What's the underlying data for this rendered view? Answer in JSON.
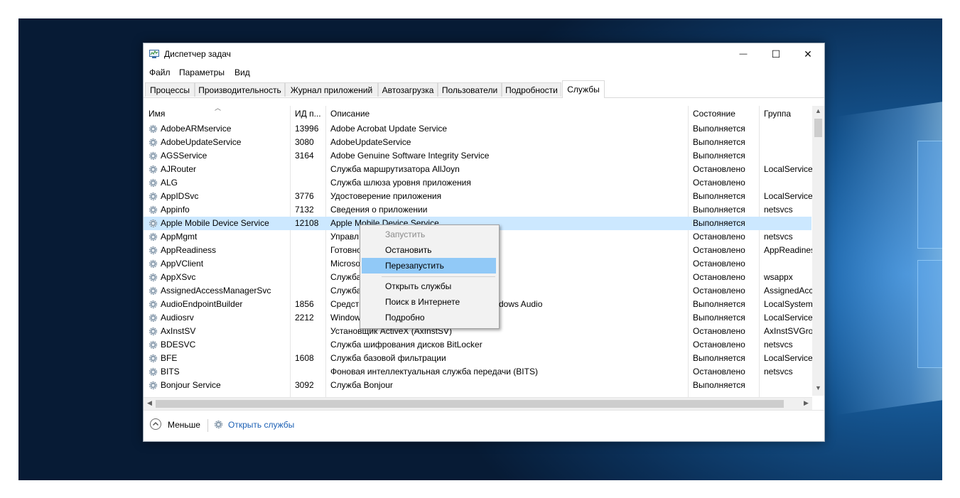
{
  "window": {
    "title": "Диспетчер задач",
    "controls": {
      "minimize": "—",
      "maximize": "☐",
      "close": "✕"
    }
  },
  "menu": [
    "Файл",
    "Параметры",
    "Вид"
  ],
  "tabs": [
    "Процессы",
    "Производительность",
    "Журнал приложений",
    "Автозагрузка",
    "Пользователи",
    "Подробности",
    "Службы"
  ],
  "active_tab": "Службы",
  "columns": {
    "name": "Имя",
    "pid": "ИД п...",
    "description": "Описание",
    "status": "Состояние",
    "group": "Группа"
  },
  "rows": [
    {
      "name": "AdobeARMservice",
      "pid": "13996",
      "description": "Adobe Acrobat Update Service",
      "status": "Выполняется",
      "group": ""
    },
    {
      "name": "AdobeUpdateService",
      "pid": "3080",
      "description": "AdobeUpdateService",
      "status": "Выполняется",
      "group": ""
    },
    {
      "name": "AGSService",
      "pid": "3164",
      "description": "Adobe Genuine Software Integrity Service",
      "status": "Выполняется",
      "group": ""
    },
    {
      "name": "AJRouter",
      "pid": "",
      "description": "Служба маршрутизатора AllJoyn",
      "status": "Остановлено",
      "group": "LocalServiceN"
    },
    {
      "name": "ALG",
      "pid": "",
      "description": "Служба шлюза уровня приложения",
      "status": "Остановлено",
      "group": ""
    },
    {
      "name": "AppIDSvc",
      "pid": "3776",
      "description": "Удостоверение приложения",
      "status": "Выполняется",
      "group": "LocalServiceN"
    },
    {
      "name": "Appinfo",
      "pid": "7132",
      "description": "Сведения о приложении",
      "status": "Выполняется",
      "group": "netsvcs"
    },
    {
      "name": "Apple Mobile Device Service",
      "pid": "12108",
      "description": "Apple Mobile Device Service",
      "status": "Выполняется",
      "group": ""
    },
    {
      "name": "AppMgmt",
      "pid": "",
      "description": "Управл",
      "status": "Остановлено",
      "group": "netsvcs"
    },
    {
      "name": "AppReadiness",
      "pid": "",
      "description": "Готовно",
      "status": "Остановлено",
      "group": "AppReadines"
    },
    {
      "name": "AppVClient",
      "pid": "",
      "description": "Microso",
      "status": "Остановлено",
      "group": ""
    },
    {
      "name": "AppXSvc",
      "pid": "",
      "description": "Служба",
      "status": "Остановлено",
      "group": "wsappx"
    },
    {
      "name": "AssignedAccessManagerSvc",
      "pid": "",
      "description": "Служба",
      "status": "Остановлено",
      "group": "AssignedAcc"
    },
    {
      "name": "AudioEndpointBuilder",
      "pid": "1856",
      "description": "Средств",
      "description_tail": "dows Audio",
      "status": "Выполняется",
      "group": "LocalSystemN"
    },
    {
      "name": "Audiosrv",
      "pid": "2212",
      "description": "Window",
      "status": "Выполняется",
      "group": "LocalServiceN"
    },
    {
      "name": "AxInstSV",
      "pid": "",
      "description": "Установщик ActiveX (AxInstSV)",
      "status": "Остановлено",
      "group": "AxInstSVGrou"
    },
    {
      "name": "BDESVC",
      "pid": "",
      "description": "Служба шифрования дисков BitLocker",
      "status": "Остановлено",
      "group": "netsvcs"
    },
    {
      "name": "BFE",
      "pid": "1608",
      "description": "Служба базовой фильтрации",
      "status": "Выполняется",
      "group": "LocalServiceN"
    },
    {
      "name": "BITS",
      "pid": "",
      "description": "Фоновая интеллектуальная служба передачи (BITS)",
      "status": "Остановлено",
      "group": "netsvcs"
    },
    {
      "name": "Bonjour Service",
      "pid": "3092",
      "description": "Служба Bonjour",
      "status": "Выполняется",
      "group": ""
    }
  ],
  "selected_row": "Apple Mobile Device Service",
  "context_menu": {
    "start": "Запустить",
    "stop": "Остановить",
    "restart": "Перезапустить",
    "open_services": "Открыть службы",
    "search_online": "Поиск в Интернете",
    "details": "Подробно",
    "highlighted": "Перезапустить",
    "disabled": [
      "Запустить"
    ]
  },
  "footer": {
    "fewer_details": "Меньше",
    "open_services": "Открыть службы"
  },
  "colors": {
    "selection": "#cce8ff",
    "menu_highlight": "#91c9f7",
    "link": "#1a5fb4"
  }
}
